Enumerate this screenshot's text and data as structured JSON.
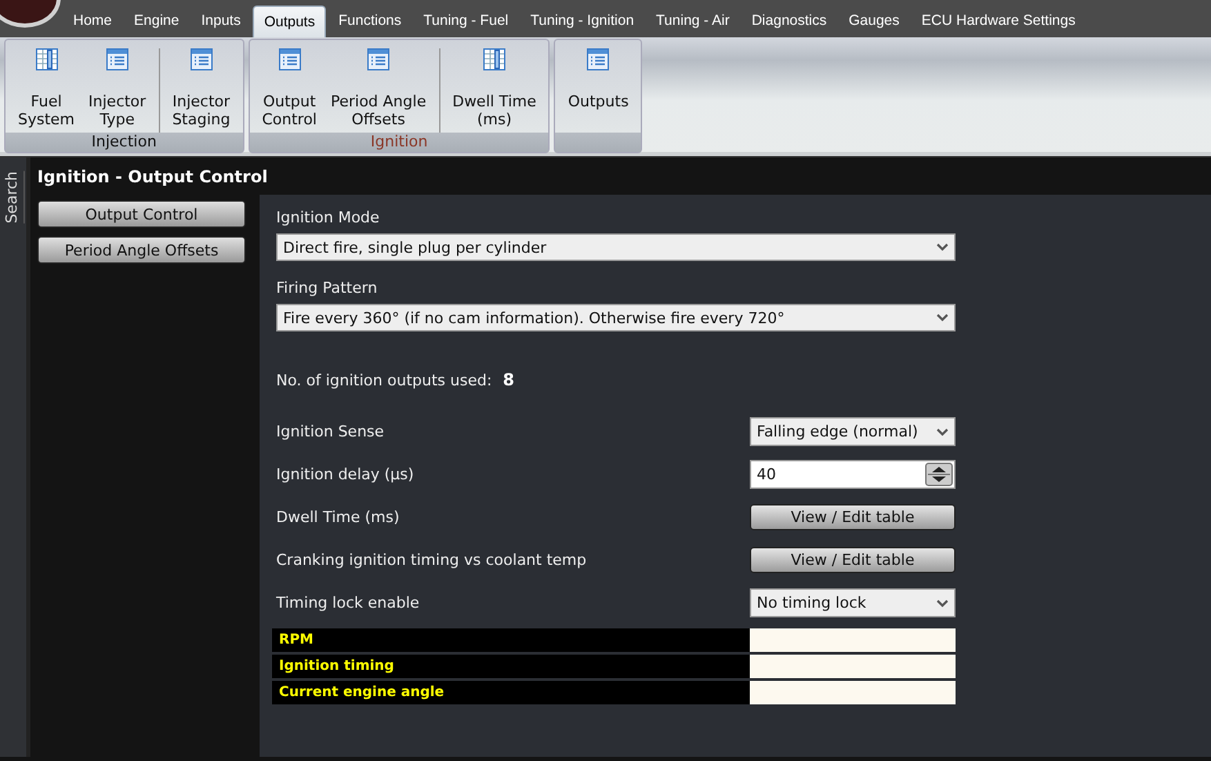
{
  "menu_tabs": [
    {
      "label": "Home",
      "selected": false
    },
    {
      "label": "Engine",
      "selected": false
    },
    {
      "label": "Inputs",
      "selected": false
    },
    {
      "label": "Outputs",
      "selected": true
    },
    {
      "label": "Functions",
      "selected": false
    },
    {
      "label": "Tuning - Fuel",
      "selected": false
    },
    {
      "label": "Tuning - Ignition",
      "selected": false
    },
    {
      "label": "Tuning - Air",
      "selected": false
    },
    {
      "label": "Diagnostics",
      "selected": false
    },
    {
      "label": "Gauges",
      "selected": false
    },
    {
      "label": "ECU Hardware Settings",
      "selected": false
    }
  ],
  "ribbon_groups": [
    {
      "label": "Injection",
      "active": false,
      "items": [
        {
          "label": "Fuel\nSystem",
          "kind": "table",
          "separated": false
        },
        {
          "label": "Injector\nType",
          "kind": "list",
          "separated": false
        },
        {
          "label": "Injector\nStaging",
          "kind": "list",
          "separated": true
        }
      ]
    },
    {
      "label": "Ignition",
      "active": true,
      "items": [
        {
          "label": "Output\nControl",
          "kind": "list",
          "separated": false
        },
        {
          "label": "Period Angle\nOffsets",
          "kind": "list",
          "separated": false
        },
        {
          "label": "Dwell Time\n(ms)",
          "kind": "table",
          "separated": true
        }
      ]
    },
    {
      "items": [
        {
          "label": "Outputs",
          "kind": "list",
          "separated": false
        }
      ]
    }
  ],
  "side_panel": {
    "label": "Search"
  },
  "page_title": "Ignition - Output Control",
  "nav_buttons": [
    {
      "label": "Output Control"
    },
    {
      "label": "Period Angle Offsets"
    }
  ],
  "settings_wide": [
    {
      "label": "Ignition Mode",
      "value": "Direct fire, single plug per cylinder"
    },
    {
      "label": "Firing Pattern",
      "value": "Fire every 360° (if no cam information). Otherwise fire every 720°"
    }
  ],
  "outputs_used": {
    "label": "No. of ignition outputs used:",
    "value": "8"
  },
  "settings": [
    {
      "label": "Ignition Sense",
      "kind": "dropdown",
      "value": "Falling edge (normal)"
    },
    {
      "label": "Ignition delay (µs)",
      "kind": "spinner",
      "value": "40"
    },
    {
      "label": "Dwell Time (ms)",
      "kind": "button",
      "value": "View / Edit table"
    },
    {
      "label": "Cranking ignition timing vs coolant temp",
      "kind": "button",
      "value": "View / Edit table"
    },
    {
      "label": "Timing lock enable",
      "kind": "dropdown",
      "value": "No timing lock"
    }
  ],
  "monitor_rows": [
    {
      "label": "RPM"
    },
    {
      "label": "Ignition timing"
    },
    {
      "label": "Current engine angle"
    }
  ]
}
